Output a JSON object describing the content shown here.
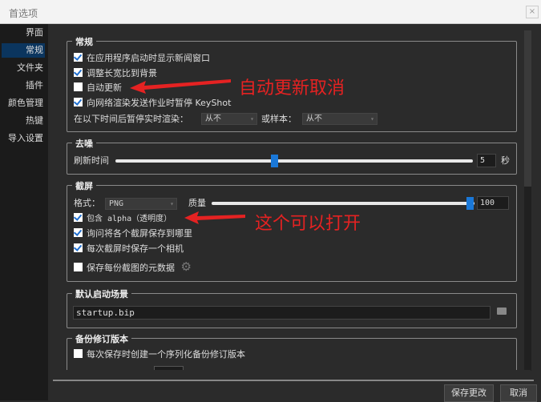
{
  "window": {
    "title": "首选项",
    "close": "×"
  },
  "sidebar": {
    "items": [
      "界面",
      "常规",
      "文件夹",
      "插件",
      "颜色管理",
      "热键",
      "导入设置"
    ],
    "selected": 1
  },
  "general": {
    "title": "常规",
    "options": [
      {
        "label": "在应用程序启动时显示新闻窗口",
        "checked": true
      },
      {
        "label": "调整长宽比到背景",
        "checked": true
      },
      {
        "label": "自动更新",
        "checked": false
      },
      {
        "label": "向网络渲染发送作业时暂停 KeyShot",
        "checked": true
      }
    ],
    "pause_label": "在以下时间后暂停实时渲染：",
    "pause_value": "从不",
    "samples_label": "或样本：",
    "samples_value": "从不"
  },
  "denoise": {
    "title": "去噪",
    "refresh_label": "刷新时间",
    "refresh_value": "5",
    "unit": "秒",
    "slider_fraction": 0.44
  },
  "screenshot": {
    "title": "截屏",
    "format_label": "格式：",
    "format_value": "PNG",
    "quality_label": "质量",
    "quality_value": "100",
    "quality_fraction": 1.0,
    "options": [
      {
        "label": "包含 alpha（透明度）",
        "checked": true
      },
      {
        "label": "询问将各个截屏保存到哪里",
        "checked": true
      },
      {
        "label": "每次截屏时保存一个相机",
        "checked": true
      },
      {
        "label": "保存每份截图的元数据",
        "checked": false
      }
    ]
  },
  "startup": {
    "title": "默认启动场景",
    "value": "startup.bip"
  },
  "backup": {
    "title": "备份修订版本",
    "option": "每次保存时创建一个序列化备份修订版本",
    "option_checked": false
  },
  "buttons": {
    "save": "保存更改",
    "cancel": "取消"
  },
  "annotations": {
    "auto_update": "自动更新取消",
    "alpha": "这个可以打开"
  },
  "colors": {
    "accent": "#1a78d8",
    "annotation": "#e52222",
    "selected": "#0b355e"
  }
}
